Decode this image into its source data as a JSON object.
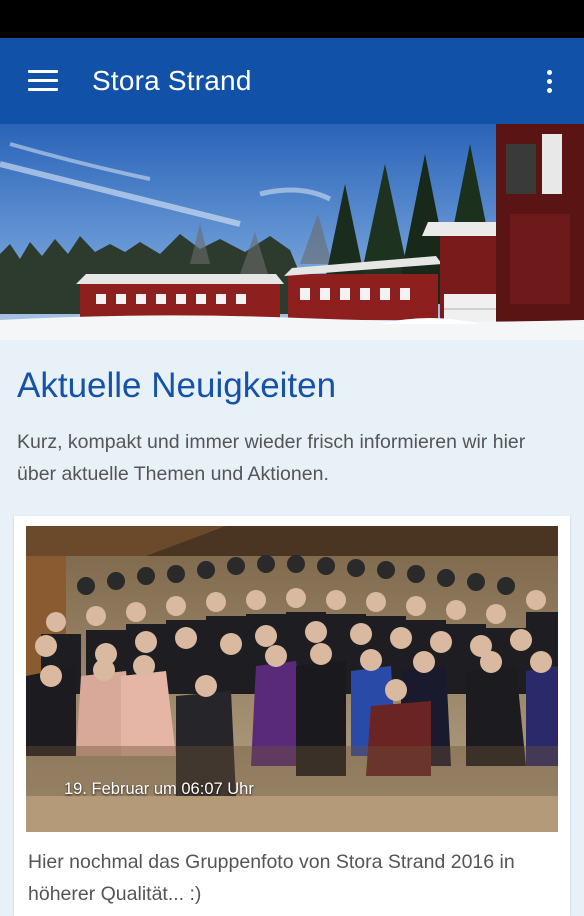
{
  "app_bar": {
    "title": "Stora Strand",
    "menu_icon": "hamburger-menu-icon",
    "overflow_icon": "more-vertical-icon",
    "color": "#1251a8"
  },
  "section": {
    "title": "Aktuelle Neuigkeiten",
    "intro": "Kurz, kompakt und immer wieder frisch informieren wir hier über aktuelle Themen und Aktionen."
  },
  "news": [
    {
      "date": "19. Februar um 06:07 Uhr",
      "text": "Hier nochmal das Gruppenfoto von Stora Strand 2016 in höherer Qualität... :)"
    }
  ],
  "colors": {
    "accent": "#1553a8",
    "background": "#e8f0f8"
  }
}
